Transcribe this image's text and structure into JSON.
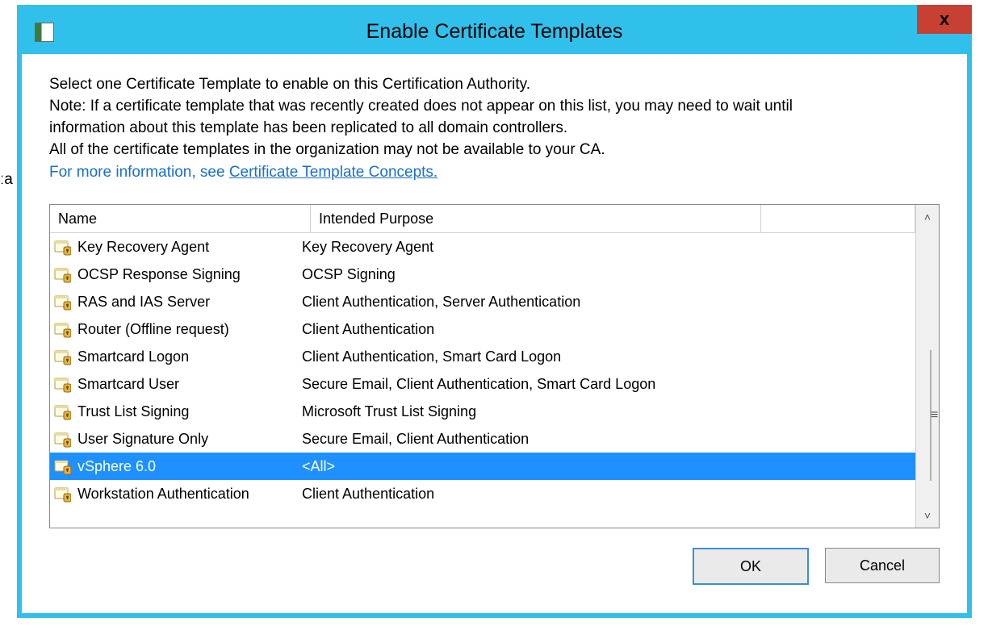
{
  "window": {
    "title": "Enable Certificate Templates"
  },
  "blurb": {
    "line1": "Select one Certificate Template to enable on this Certification Authority.",
    "line2": "Note: If a certificate template that was recently created does not appear on this list, you may need to wait until",
    "line3": "information about this template has been replicated to all domain controllers.",
    "line4": "All of the certificate templates in the organization may not be available to your CA."
  },
  "link": {
    "prefix": "For more information, see ",
    "text": "Certificate Template Concepts."
  },
  "headers": {
    "name": "Name",
    "purpose": "Intended Purpose"
  },
  "rows": [
    {
      "name": "Key Recovery Agent",
      "purpose": "Key Recovery Agent",
      "selected": false
    },
    {
      "name": "OCSP Response Signing",
      "purpose": "OCSP Signing",
      "selected": false
    },
    {
      "name": "RAS and IAS Server",
      "purpose": "Client Authentication, Server Authentication",
      "selected": false
    },
    {
      "name": "Router (Offline request)",
      "purpose": "Client Authentication",
      "selected": false
    },
    {
      "name": "Smartcard Logon",
      "purpose": "Client Authentication, Smart Card Logon",
      "selected": false
    },
    {
      "name": "Smartcard User",
      "purpose": "Secure Email, Client Authentication, Smart Card Logon",
      "selected": false
    },
    {
      "name": "Trust List Signing",
      "purpose": "Microsoft Trust List Signing",
      "selected": false
    },
    {
      "name": "User Signature Only",
      "purpose": "Secure Email, Client Authentication",
      "selected": false
    },
    {
      "name": "vSphere 6.0",
      "purpose": "<All>",
      "selected": true
    },
    {
      "name": "Workstation Authentication",
      "purpose": "Client Authentication",
      "selected": false
    }
  ],
  "scroll": {
    "grip": "≡",
    "up": "˄",
    "down": "˅"
  },
  "buttons": {
    "ok": "OK",
    "cancel": "Cancel"
  },
  "stray": "ːa"
}
